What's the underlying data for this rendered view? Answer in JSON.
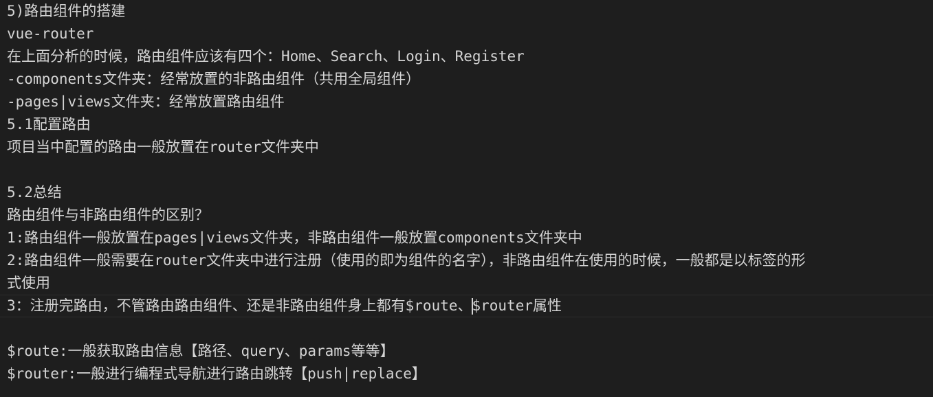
{
  "editor": {
    "lines": [
      "5)路由组件的搭建",
      "vue-router",
      "在上面分析的时候，路由组件应该有四个：Home、Search、Login、Register",
      "-components文件夹：经常放置的非路由组件（共用全局组件）",
      "-pages|views文件夹：经常放置路由组件",
      "5.1配置路由",
      "项目当中配置的路由一般放置在router文件夹中",
      "",
      "5.2总结",
      "路由组件与非路由组件的区别？",
      "1:路由组件一般放置在pages|views文件夹，非路由组件一般放置components文件夹中",
      "2:路由组件一般需要在router文件夹中进行注册（使用的即为组件的名字），非路由组件在使用的时候，一般都是以标签的形",
      "式使用",
      "",
      "",
      "$route:一般获取路由信息【路径、query、params等等】",
      "$router:一般进行编程式导航进行路由跳转【push|replace】"
    ],
    "current_line_before_cursor": "3：注册完路由，不管路由路由组件、还是非路由组件身上都有$route、",
    "current_line_after_cursor": "$router属性"
  }
}
